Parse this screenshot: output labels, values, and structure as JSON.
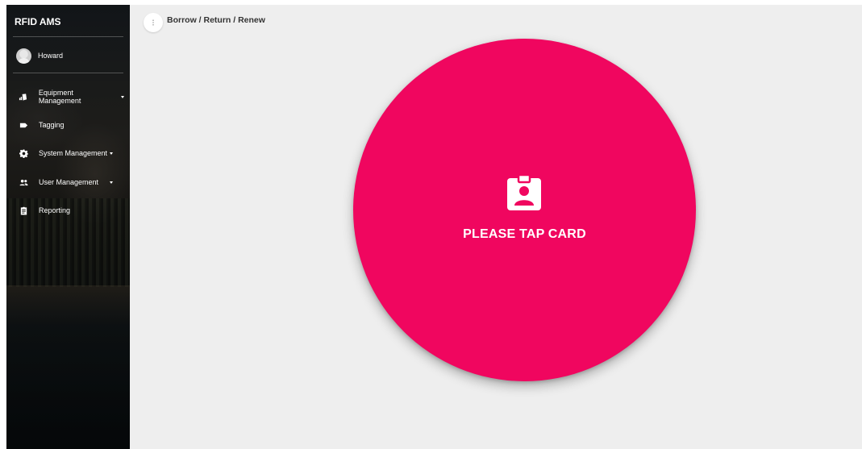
{
  "sidebar": {
    "brand": "RFID AMS",
    "user": {
      "name": "Howard",
      "avatar_icon": "account-circle-icon"
    },
    "items": [
      {
        "label": "Equipment Management",
        "icon": "equipment-icon",
        "has_caret": true
      },
      {
        "label": "Tagging",
        "icon": "label-tag-icon",
        "has_caret": false
      },
      {
        "label": "System Management",
        "icon": "gear-icon",
        "has_caret": true
      },
      {
        "label": "User Management",
        "icon": "people-icon",
        "has_caret": true
      },
      {
        "label": "Reporting",
        "icon": "clipboard-icon",
        "has_caret": false
      }
    ]
  },
  "header": {
    "menu_icon": "more-vert-icon",
    "breadcrumb": "Borrow / Return / Renew"
  },
  "main": {
    "prompt": "PLEASE TAP CARD",
    "prompt_icon": "badge-card-icon"
  },
  "colors": {
    "accent": "#f0065f",
    "background": "#eeeeee",
    "sidebar_text": "#ffffff"
  }
}
